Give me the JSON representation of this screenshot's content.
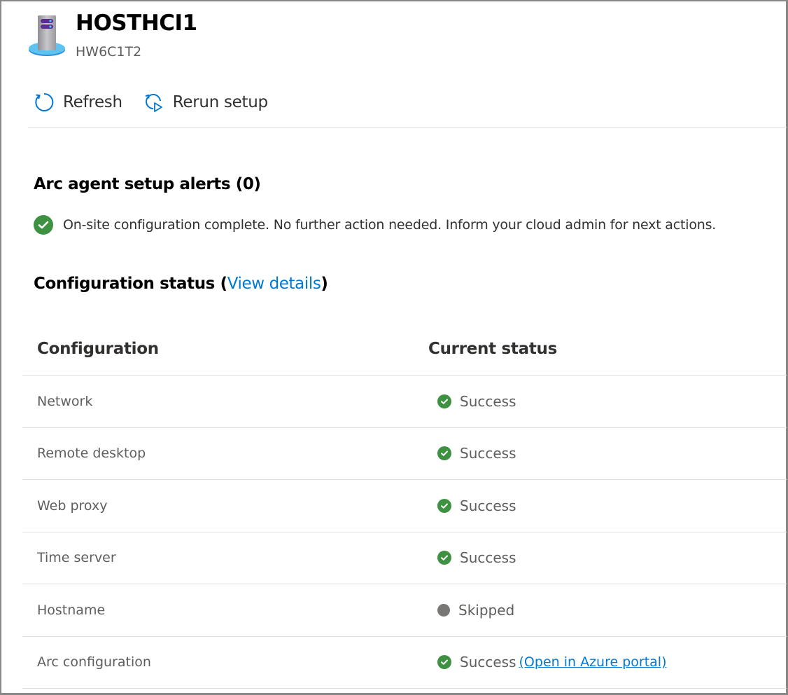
{
  "header": {
    "title": "HOSTHCI1",
    "subtitle": "HW6C1T2",
    "icon": "server-icon"
  },
  "toolbar": {
    "refresh_label": "Refresh",
    "rerun_label": "Rerun setup"
  },
  "alerts": {
    "title": "Arc agent setup alerts (0)",
    "message": "On-site configuration complete. No further action needed. Inform your cloud admin for next actions."
  },
  "config_status": {
    "title": "Configuration status (",
    "link": "View details",
    "close": ")"
  },
  "table": {
    "headers": [
      "Configuration",
      "Current status"
    ],
    "rows": [
      {
        "name": "Network",
        "status": "Success",
        "state": "success"
      },
      {
        "name": "Remote desktop",
        "status": "Success",
        "state": "success"
      },
      {
        "name": "Web proxy",
        "status": "Success",
        "state": "success"
      },
      {
        "name": "Time server",
        "status": "Success",
        "state": "success"
      },
      {
        "name": "Hostname",
        "status": "Skipped",
        "state": "skipped"
      },
      {
        "name": "Arc configuration",
        "status": "Success",
        "state": "success",
        "link": "(Open in Azure portal)"
      }
    ]
  },
  "colors": {
    "accent": "#0078d4",
    "success": "#3f9142",
    "skipped": "#797775",
    "text": "#323130"
  }
}
